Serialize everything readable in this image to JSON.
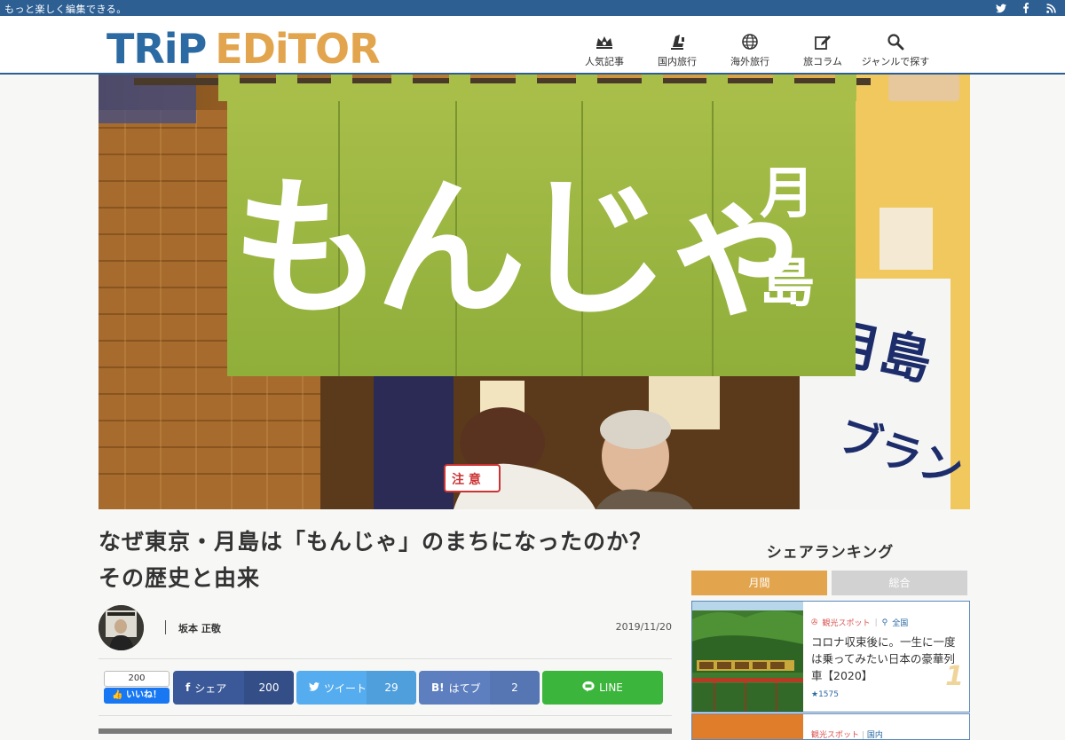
{
  "topbar": {
    "tagline": "もっと楽しく編集できる。",
    "social_icons": [
      "twitter-icon",
      "facebook-icon",
      "rss-icon"
    ]
  },
  "header": {
    "logo_trip": "TRiP",
    "logo_editor": "EDiTOR",
    "nav": [
      {
        "label": "人気記事",
        "icon": "crown-icon"
      },
      {
        "label": "国内旅行",
        "icon": "seat-icon"
      },
      {
        "label": "海外旅行",
        "icon": "globe-icon"
      },
      {
        "label": "旅コラム",
        "icon": "edit-icon"
      },
      {
        "label": "ジャンルで探す",
        "icon": "search-icon"
      }
    ]
  },
  "hero": {
    "noren_text": "もんじゃ",
    "noren_place": "月島"
  },
  "article": {
    "title": "なぜ東京・月島は「もんじゃ」のまちになったのか？その歴史と由来",
    "author": "坂本 正敬",
    "date": "2019/11/20"
  },
  "share": {
    "like_count": "200",
    "like_label": "いいね！",
    "facebook_label": "シェア",
    "facebook_count": "200",
    "twitter_label": "ツイート",
    "twitter_count": "29",
    "hatena_label": "はてブ",
    "hatena_prefix": "B!",
    "hatena_count": "2",
    "line_label": "LINE"
  },
  "sidebar": {
    "title": "シェアランキング",
    "tabs": [
      "月間",
      "総合"
    ],
    "ranking": [
      {
        "category": "観光スポット",
        "area": "全国",
        "title": "コロナ収束後に。一生に一度は乗ってみたい日本の豪華列車【2020】",
        "count": "★1575",
        "rank": "1"
      },
      {
        "category": "観光スポット",
        "area": "国内"
      }
    ]
  },
  "colors": {
    "brand_blue": "#2d5f93",
    "brand_orange": "#e2a54e",
    "facebook": "#3b5998",
    "twitter": "#55acee",
    "hatena": "#5d7fbf",
    "line": "#3bb53b"
  }
}
